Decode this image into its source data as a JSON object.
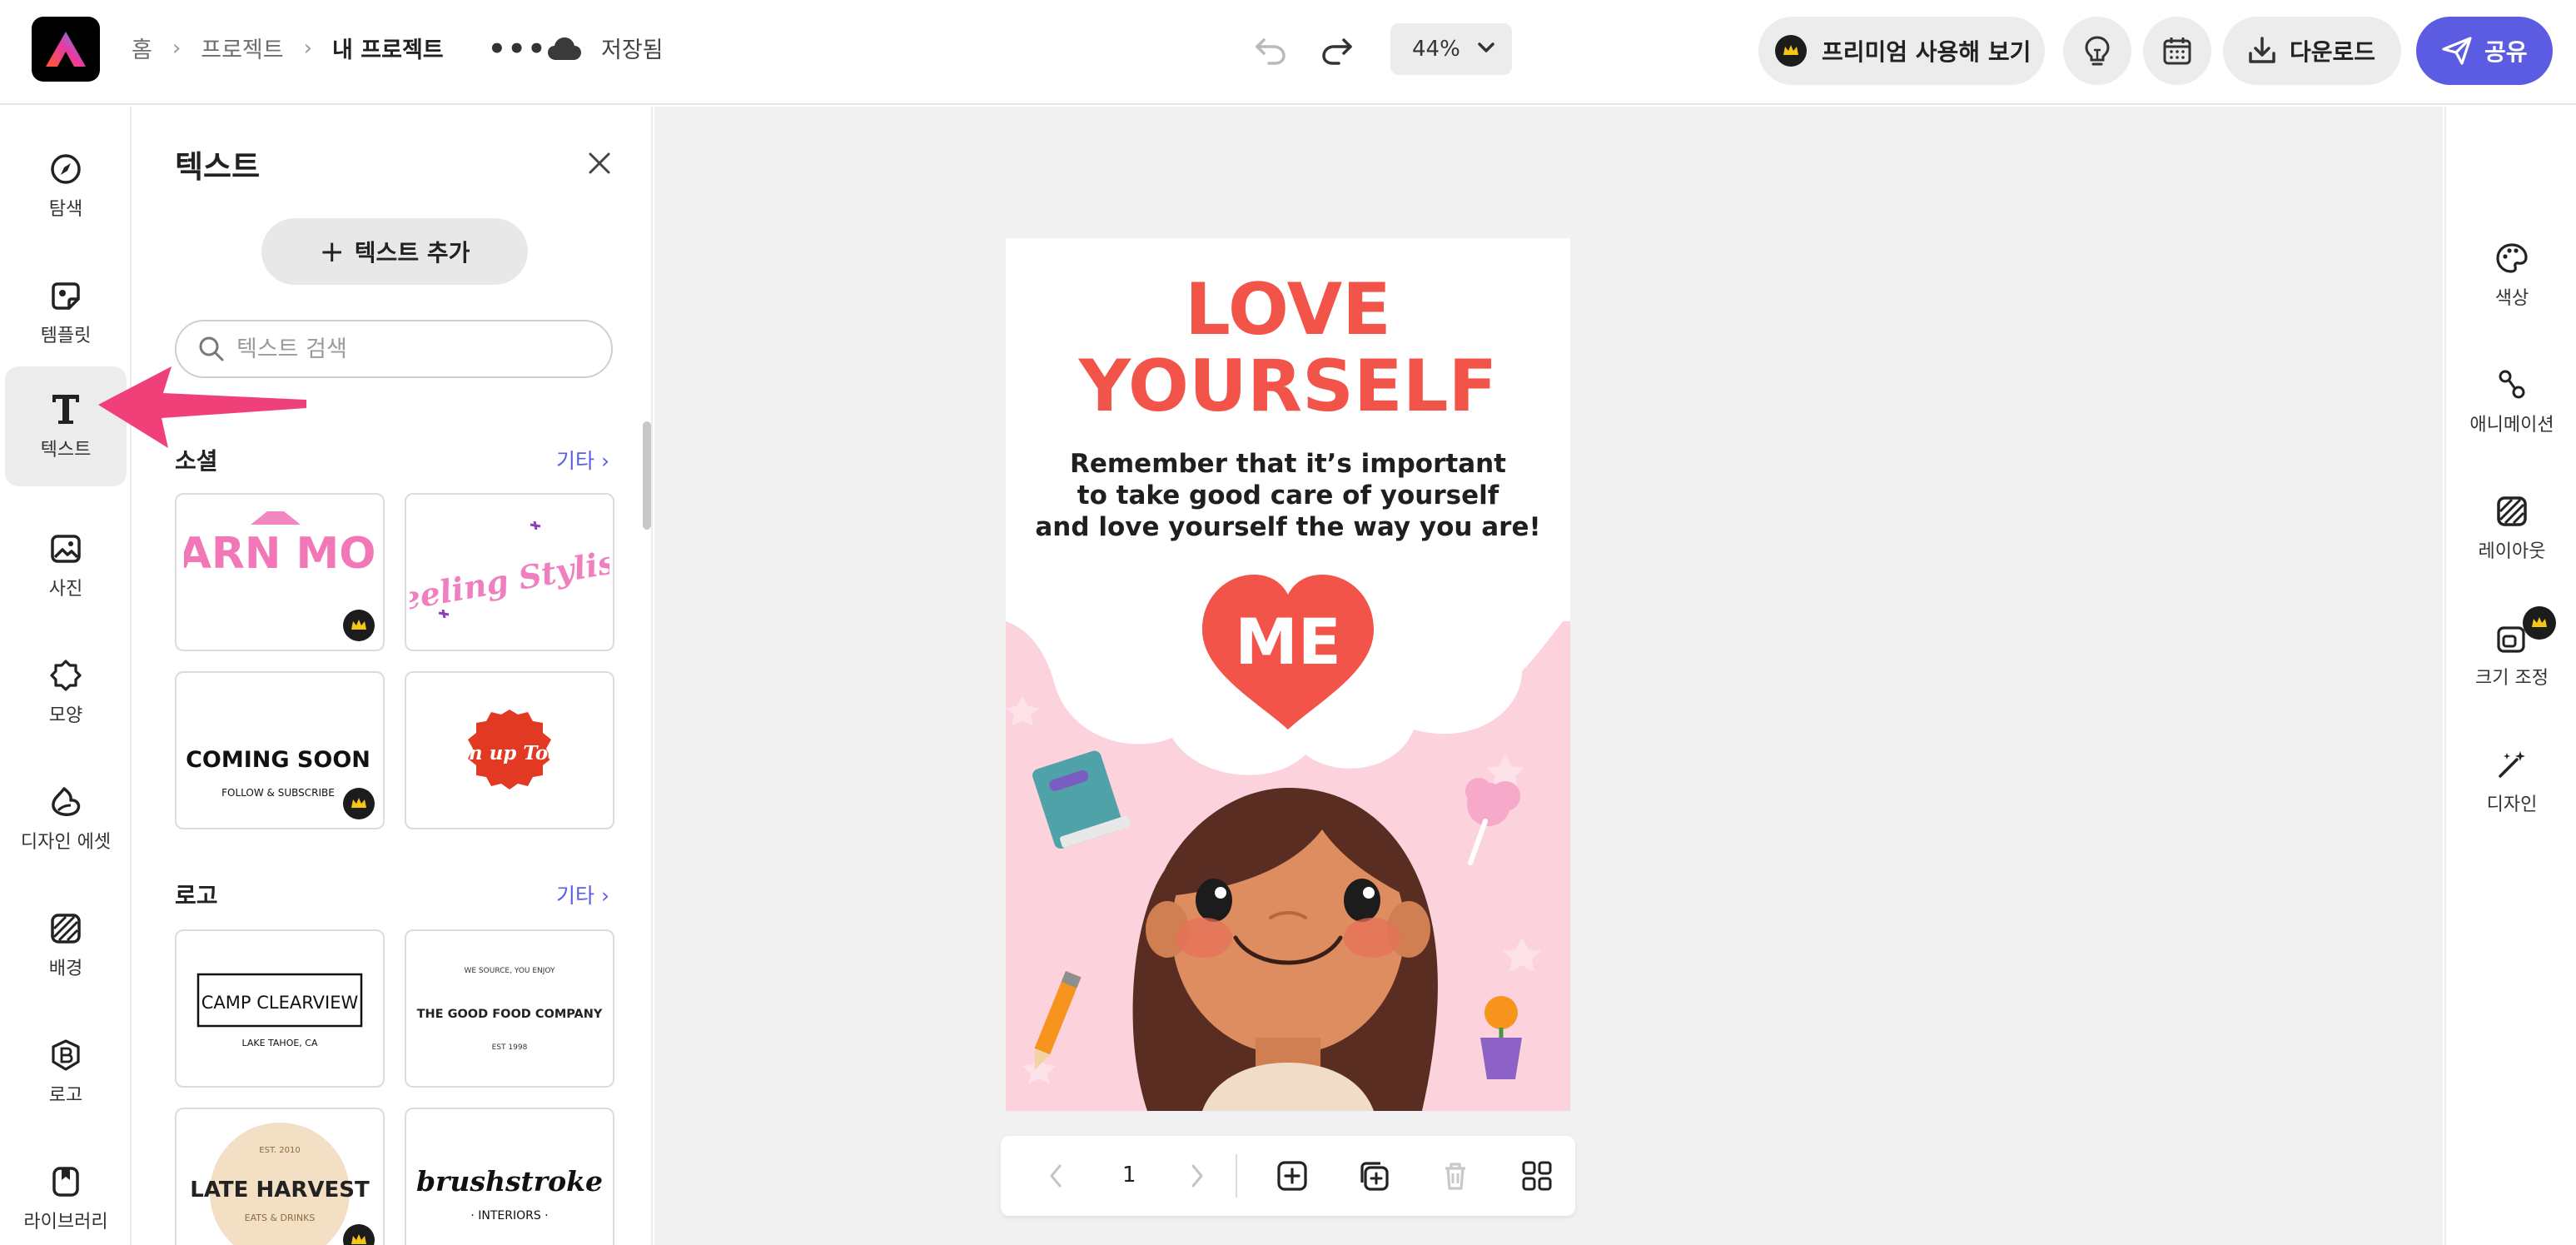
{
  "header": {
    "breadcrumb": [
      "홈",
      "프로젝트",
      "내 프로젝트"
    ],
    "more_label": "•••",
    "saved_label": "저장됨",
    "zoom_value": "44%",
    "premium_label": "프리미엄 사용해 보기",
    "download_label": "다운로드",
    "share_label": "공유"
  },
  "left_rail": {
    "items": [
      {
        "label": "탐색",
        "icon": "compass-icon"
      },
      {
        "label": "템플릿",
        "icon": "template-icon"
      },
      {
        "label": "텍스트",
        "icon": "text-t-icon",
        "active": true
      },
      {
        "label": "사진",
        "icon": "photo-icon"
      },
      {
        "label": "모양",
        "icon": "shape-icon"
      },
      {
        "label": "디자인 에셋",
        "icon": "design-assets-icon"
      },
      {
        "label": "배경",
        "icon": "background-icon"
      },
      {
        "label": "로고",
        "icon": "logo-badge-icon"
      },
      {
        "label": "라이브러리",
        "icon": "library-icon"
      }
    ]
  },
  "text_panel": {
    "title": "텍스트",
    "add_text_label": "텍스트 추가",
    "search_placeholder": "텍스트 검색",
    "sections": [
      {
        "title": "소셜",
        "more": "기타",
        "items": [
          {
            "text": "LEARN MORE",
            "premium": true
          },
          {
            "text": "Feeling Stylish",
            "premium": false
          },
          {
            "text": "COMING SOON",
            "sub": "FOLLOW & SUBSCRIBE",
            "premium": true
          },
          {
            "text": "Sign up Today",
            "premium": false
          }
        ]
      },
      {
        "title": "로고",
        "more": "기타",
        "items": [
          {
            "text": "CAMP CLEARVIEW",
            "sub": "LAKE TAHOE, CA",
            "premium": false
          },
          {
            "text": "THE GOOD FOOD COMPANY",
            "top": "WE SOURCE, YOU ENJOY",
            "sub": "EST 1998",
            "premium": false
          },
          {
            "text": "LATE HARVEST",
            "top": "EST. 2010",
            "sub": "EATS & DRINKS",
            "premium": true
          },
          {
            "text": "brushstroke",
            "sub": "· INTERIORS ·",
            "premium": false
          }
        ]
      }
    ]
  },
  "canvas": {
    "title_line1": "LOVE",
    "title_line2": "YOURSELF",
    "body_line1": "Remember that it’s important",
    "body_line2": "to take good care of yourself",
    "body_line3": "and love yourself the way you are!",
    "heart_text": "ME",
    "page_number": "1",
    "colors": {
      "title": "#f2544a",
      "pink_bg": "#fcd3dc",
      "heart": "#f2544a"
    }
  },
  "right_rail": {
    "items": [
      {
        "label": "색상",
        "icon": "palette-icon"
      },
      {
        "label": "애니메이션",
        "icon": "animation-icon"
      },
      {
        "label": "레이아웃",
        "icon": "layout-icon"
      },
      {
        "label": "크기 조정",
        "icon": "resize-icon",
        "premium": true
      },
      {
        "label": "디자인",
        "icon": "magic-wand-icon"
      }
    ]
  },
  "colors": {
    "accent": "#5b5ce2",
    "annotation_arrow": "#f0407a"
  }
}
